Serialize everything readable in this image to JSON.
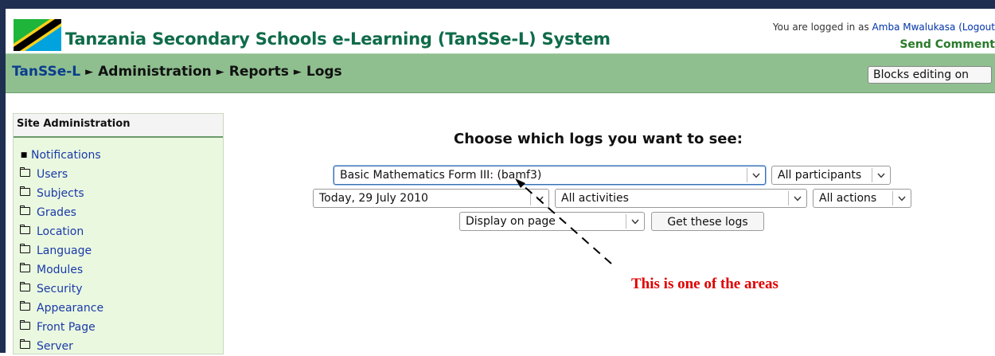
{
  "colors": {
    "frame": "#1f2f52",
    "title_green": "#0f6b4a",
    "navbar": "#8fbf8f",
    "sidebar_bg": "#eaf8e0",
    "annotation_red": "#e00000",
    "link_blue": "#1a3aa8"
  },
  "header": {
    "title": "Tanzania Secondary Schools e-Learning (TanSSe-L) System",
    "logo_icon": "tanzania-flag-icon",
    "login_prefix": "You are logged in as",
    "user_name": "Amba Mwalukasa",
    "logout_label": "(Logout",
    "send_comment": "Send Comment"
  },
  "breadcrumb": {
    "home": "TanSSe-L",
    "items": [
      "Administration",
      "Reports",
      "Logs"
    ],
    "separator": "►"
  },
  "blocks_editing_button": "Blocks editing on",
  "sidebar": {
    "title": "Site Administration",
    "items": [
      {
        "label": "Notifications",
        "icon": "bullet-icon"
      },
      {
        "label": "Users",
        "icon": "folder-icon"
      },
      {
        "label": "Subjects",
        "icon": "folder-icon"
      },
      {
        "label": "Grades",
        "icon": "folder-icon"
      },
      {
        "label": "Location",
        "icon": "folder-icon"
      },
      {
        "label": "Language",
        "icon": "folder-icon"
      },
      {
        "label": "Modules",
        "icon": "folder-icon"
      },
      {
        "label": "Security",
        "icon": "folder-icon"
      },
      {
        "label": "Appearance",
        "icon": "folder-icon"
      },
      {
        "label": "Front Page",
        "icon": "folder-icon"
      },
      {
        "label": "Server",
        "icon": "folder-icon"
      }
    ]
  },
  "logs_form": {
    "heading": "Choose which logs you want to see:",
    "course_select": "Basic Mathematics Form III: (bamf3)",
    "participants_select": "All participants",
    "date_select": "Today, 29 July 2010",
    "activities_select": "All activities",
    "actions_select": "All actions",
    "display_select": "Display on page",
    "submit_button": "Get these logs"
  },
  "annotation": {
    "text": "This is one of the areas"
  }
}
